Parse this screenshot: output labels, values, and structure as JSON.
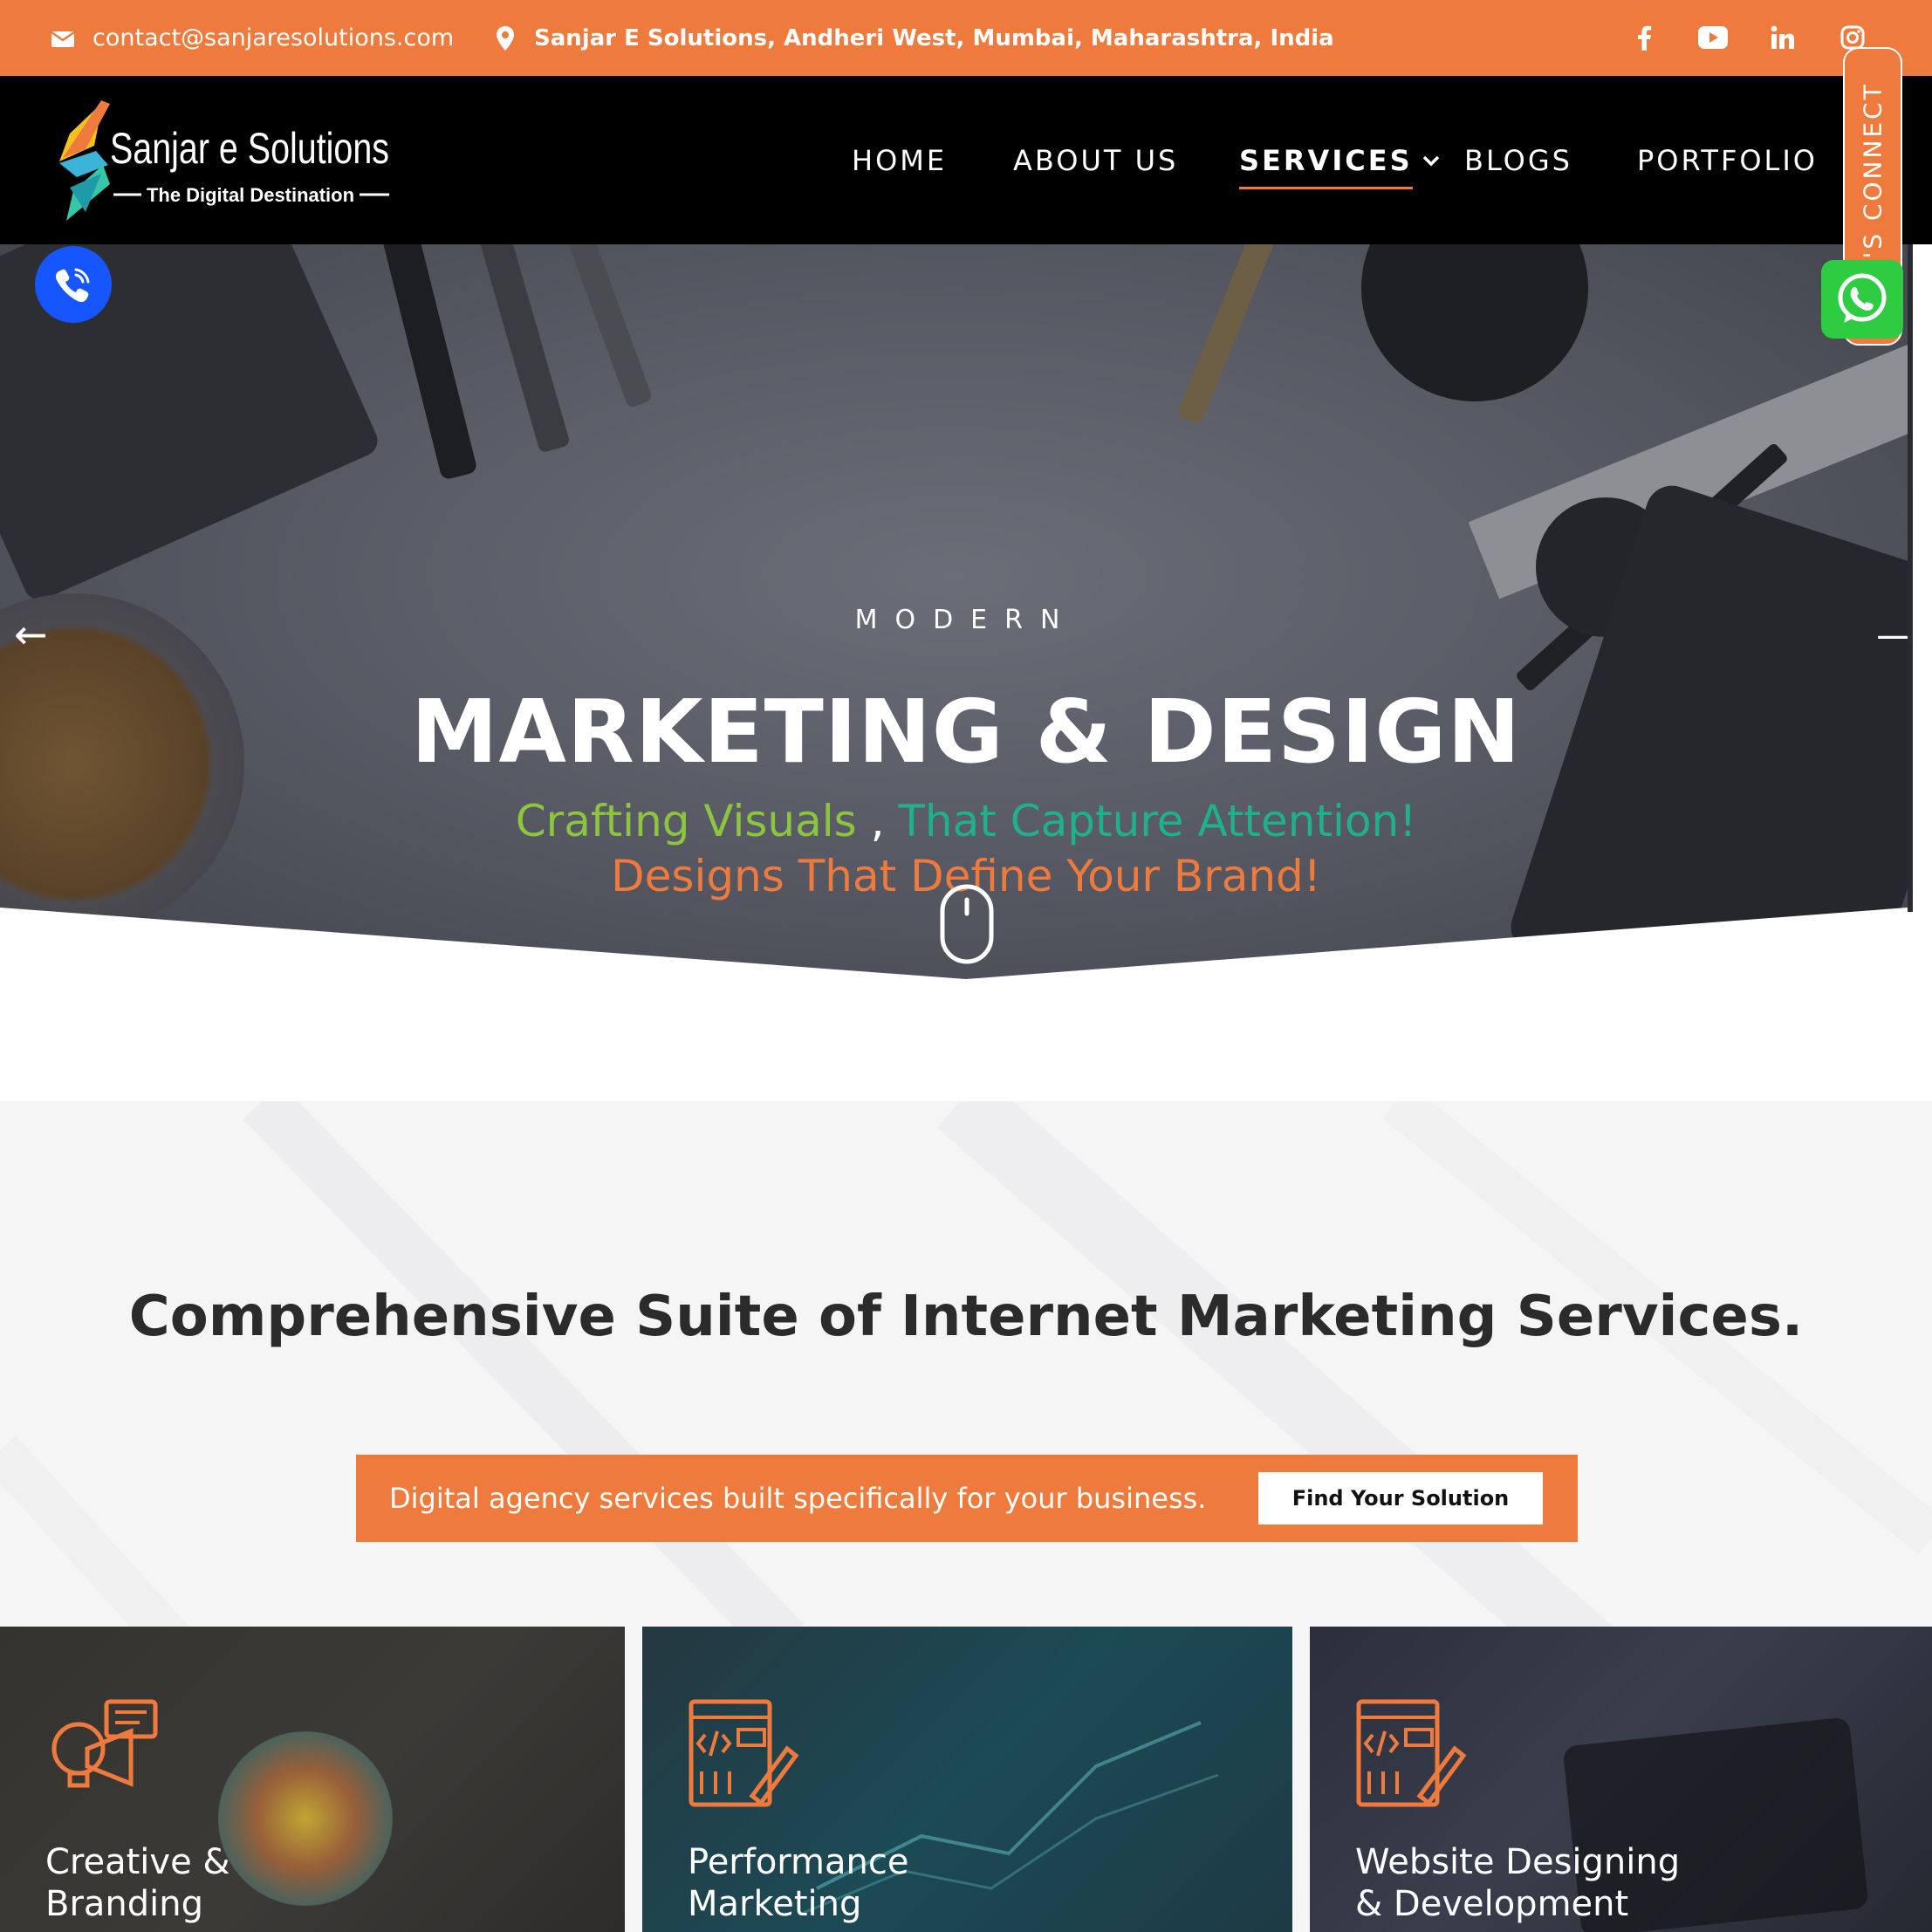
{
  "topbar": {
    "email": "contact@sanjaresolutions.com",
    "address": "Sanjar E Solutions, Andheri West, Mumbai, Maharashtra, India",
    "social": [
      {
        "name": "facebook-icon",
        "glyph": "f"
      },
      {
        "name": "youtube-icon",
        "glyph": "▶"
      },
      {
        "name": "linkedin-icon",
        "glyph": "in"
      },
      {
        "name": "instagram-icon",
        "glyph": "◎"
      }
    ]
  },
  "logo": {
    "name": "Sanjar e Solutions",
    "tagline": "The Digital Destination"
  },
  "nav": {
    "items": [
      "HOME",
      "ABOUT US",
      "SERVICES",
      "BLOGS",
      "PORTFOLIO"
    ],
    "active": "SERVICES"
  },
  "hero": {
    "eyebrow": "MODERN",
    "headline": "MARKETING & DESIGN",
    "tagline_part1": "Crafting Visuals",
    "tagline_sep": " , ",
    "tagline_part2": "That Capture Attention!",
    "tagline_line2": "Designs That Define Your Brand!",
    "prev_arrow": "←",
    "next_arrow": "—"
  },
  "floating": {
    "connect_label": "LET'S CONNECT"
  },
  "services": {
    "title": "Comprehensive Suite of Internet Marketing Services.",
    "cta_text": "Digital agency services built specifically for your business.",
    "cta_button": "Find Your Solution",
    "cards": [
      {
        "label": "Creative & Branding"
      },
      {
        "label": "Performance Marketing"
      },
      {
        "label": "Website Designing & Development"
      }
    ]
  },
  "colors": {
    "accent": "#ee7b3d",
    "green": "#8cc63f",
    "teal": "#1fb08e",
    "call_blue": "#1556ff",
    "whatsapp": "#2ecc40"
  }
}
